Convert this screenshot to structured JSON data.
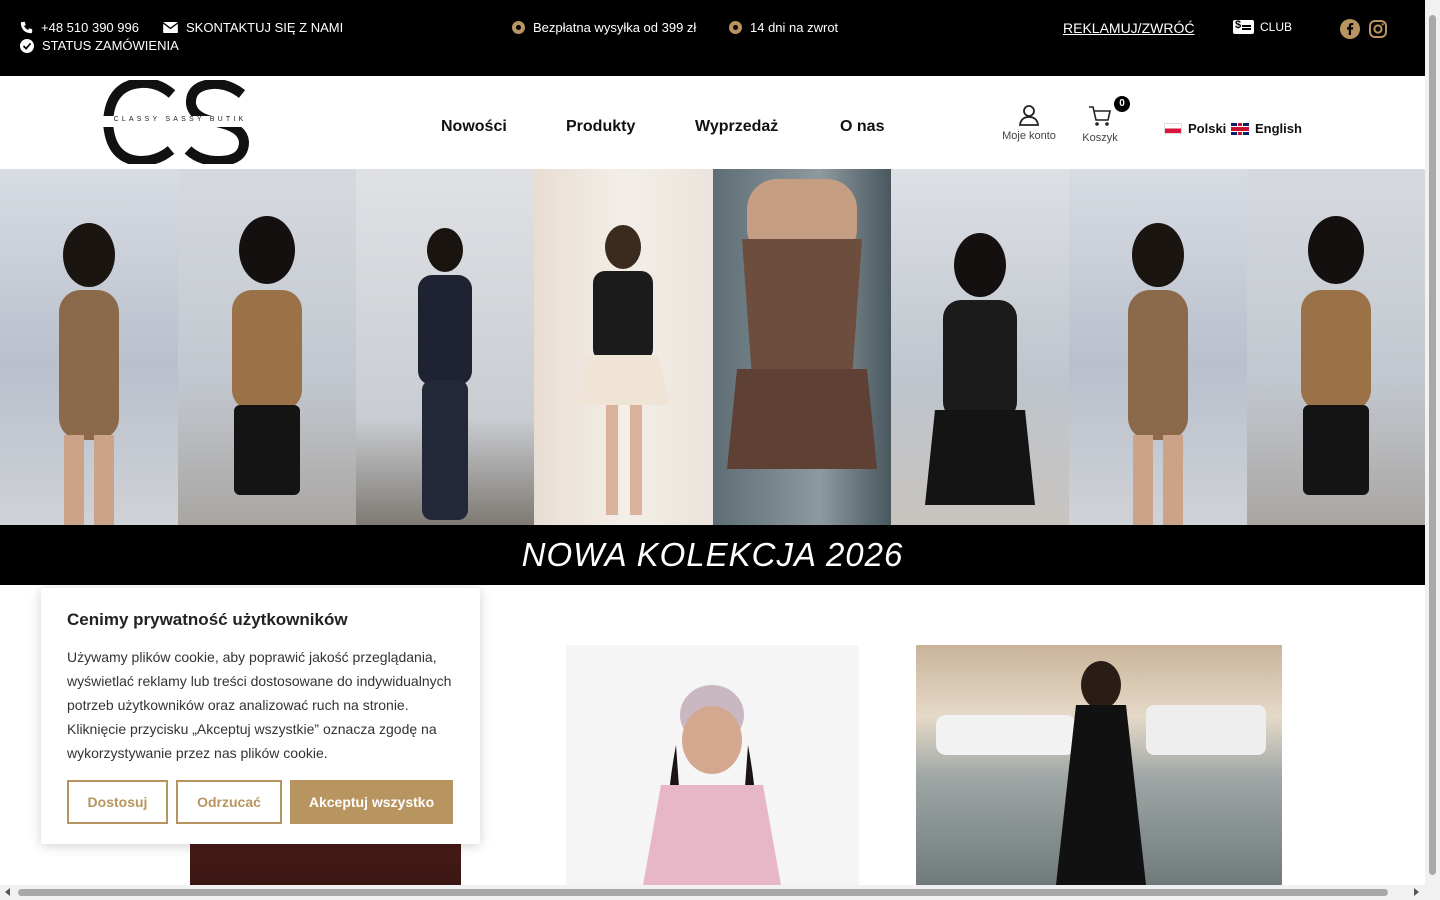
{
  "topbar": {
    "phone": "+48 510 390 996",
    "contact": "SKONTAKTUJ SIĘ Z NAMI",
    "order_status": "STATUS ZAMÓWIENIA",
    "shipping": "Bezpłatna wysyłka od 399 zł",
    "returns": "14 dni na zwrot",
    "complaint_link": "REKLAMUJ/ZWRÓĆ",
    "club": "CLUB",
    "icons": [
      "phone-icon",
      "envelope-icon",
      "check-circle-icon",
      "facebook-icon",
      "instagram-icon"
    ]
  },
  "header": {
    "logo_text": "CLASSY SASSY BUTIK",
    "nav": [
      "Nowości",
      "Produkty",
      "Wyprzedaż",
      "O nas"
    ],
    "account_label": "Moje konto",
    "cart_label": "Koszyk",
    "cart_count": "0",
    "languages": [
      "Polski",
      "English"
    ]
  },
  "hero": {
    "banner": "NOWA KOLEKCJA 2026"
  },
  "cookie": {
    "title": "Cenimy prywatność użytkowników",
    "text": "Używamy plików cookie, aby poprawić jakość przeglądania, wyświetlać reklamy lub treści dostosowane do indywidualnych potrzeb użytkowników oraz analizować ruch na stronie. Kliknięcie przycisku „Akceptuj wszystkie” oznacza zgodę na wykorzystywanie przez nas plików cookie.",
    "customize": "Dostosuj",
    "reject": "Odrzucać",
    "accept": "Akceptuj wszystko"
  },
  "colors": {
    "accent": "#b89560",
    "topbar_bg": "#000000"
  }
}
